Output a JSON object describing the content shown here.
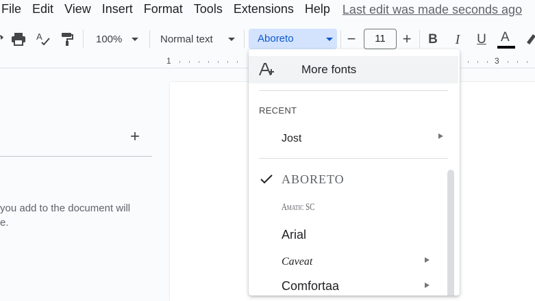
{
  "menubar": {
    "items": [
      "File",
      "Edit",
      "View",
      "Insert",
      "Format",
      "Tools",
      "Extensions",
      "Help"
    ],
    "last_edit": "Last edit was made seconds ago"
  },
  "toolbar": {
    "zoom": "100%",
    "style": "Normal text",
    "font": "Aboreto",
    "size": "11",
    "minus": "−",
    "plus": "+",
    "bold": "B",
    "italic": "I",
    "underline": "U",
    "text_color_letter": "A",
    "text_color": "#000000"
  },
  "ruler": {
    "marks": [
      "1",
      "3"
    ]
  },
  "outline": {
    "add": "+",
    "hint_line1": "you add to the document will",
    "hint_line2": "e."
  },
  "font_menu": {
    "more_fonts": "More fonts",
    "recent_header": "RECENT",
    "recent": [
      {
        "label": "Jost",
        "has_submenu": true
      }
    ],
    "fonts": [
      {
        "label": "ABORETO",
        "selected": true,
        "has_submenu": false
      },
      {
        "label": "Amatic SC",
        "selected": false,
        "has_submenu": false
      },
      {
        "label": "Arial",
        "selected": false,
        "has_submenu": false
      },
      {
        "label": "Caveat",
        "selected": false,
        "has_submenu": true
      },
      {
        "label": "Comfortaa",
        "selected": false,
        "has_submenu": true
      }
    ]
  },
  "colors": {
    "accent": "#0b57d0",
    "accent_bg": "#d3e3fd"
  }
}
